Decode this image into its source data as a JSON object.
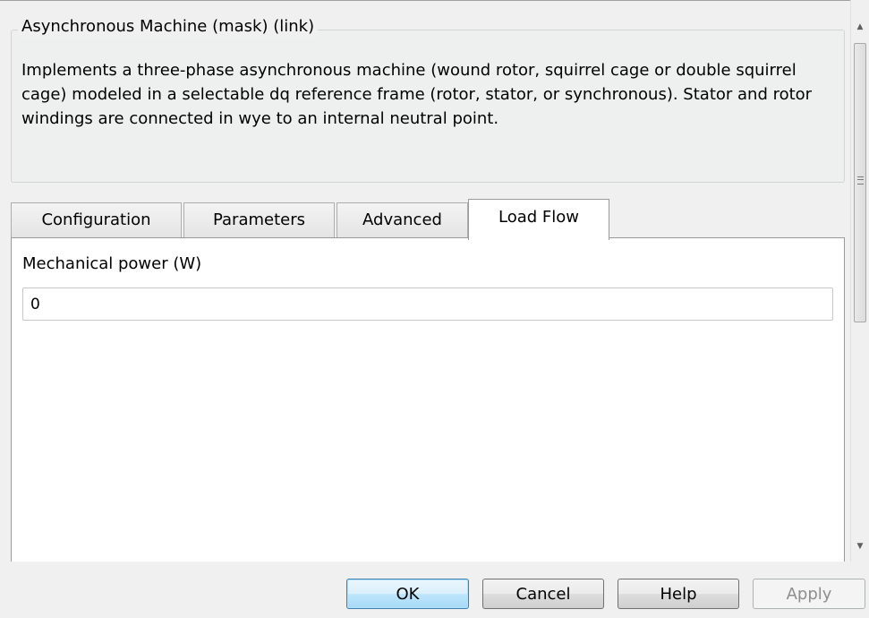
{
  "group": {
    "title": "Asynchronous Machine (mask) (link)",
    "description": "Implements a three-phase asynchronous machine (wound rotor, squirrel cage or double squirrel cage) modeled in a selectable dq reference frame (rotor, stator, or synchronous). Stator and rotor windings are connected in wye to an internal neutral point."
  },
  "tabs": [
    {
      "label": "Configuration",
      "active": false
    },
    {
      "label": "Parameters",
      "active": false
    },
    {
      "label": "Advanced",
      "active": false
    },
    {
      "label": "Load Flow",
      "active": true
    }
  ],
  "load_flow": {
    "mechanical_power_label": "Mechanical power (W)",
    "mechanical_power_value": "0"
  },
  "buttons": {
    "ok": "OK",
    "cancel": "Cancel",
    "help": "Help",
    "apply": "Apply"
  },
  "icons": {
    "scroll_up": "scroll-up-arrow",
    "scroll_down": "scroll-down-arrow"
  }
}
